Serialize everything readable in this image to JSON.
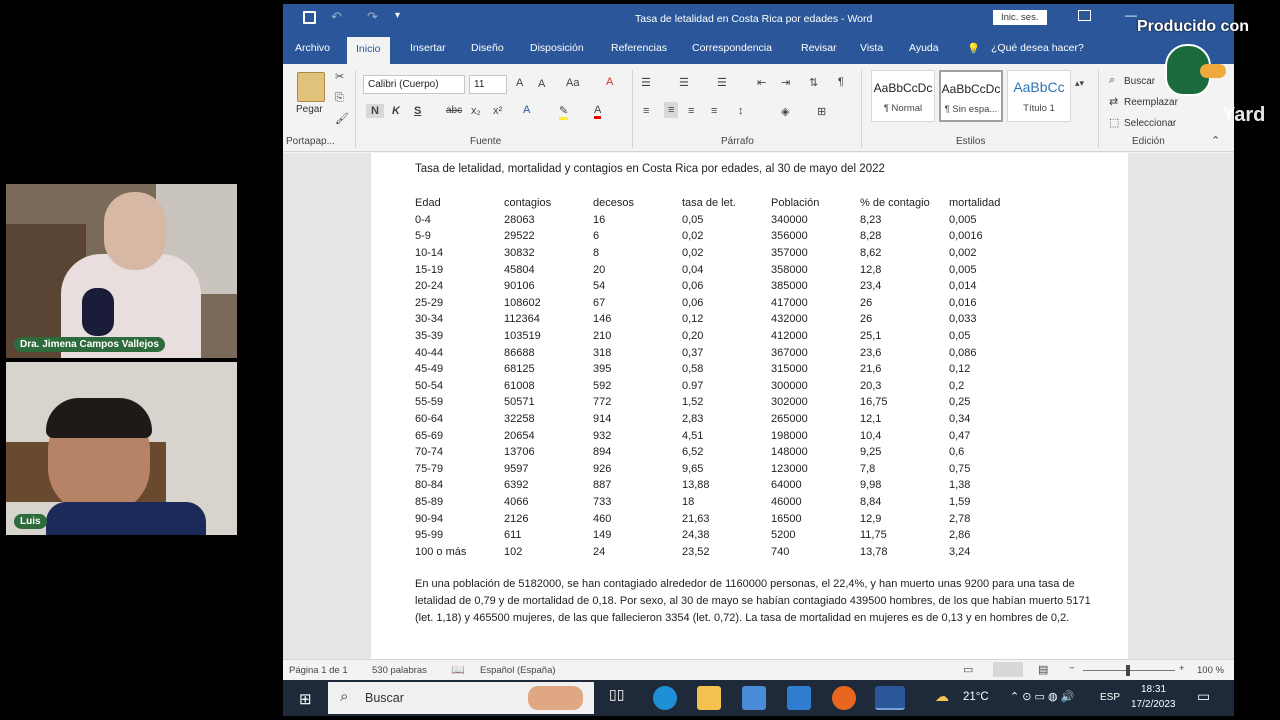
{
  "watermark": "Producido con",
  "watermark_brand": "Yard",
  "cams": [
    {
      "name": "Dra. Jimena Campos Vallejos"
    },
    {
      "name": "Luis"
    }
  ],
  "window": {
    "title": "Tasa de letalidad en Costa Rica por edades  -  Word",
    "signin": "Inic. ses."
  },
  "tabs": [
    "Archivo",
    "Inicio",
    "Insertar",
    "Diseño",
    "Disposición",
    "Referencias",
    "Correspondencia",
    "Revisar",
    "Vista",
    "Ayuda",
    "¿Qué desea hacer?"
  ],
  "ribbon": {
    "paste": "Pegar",
    "font_name": "Calibri (Cuerpo)",
    "font_size": "11",
    "groups": [
      "Portapap...",
      "Fuente",
      "Párrafo",
      "Estilos",
      "Edición"
    ],
    "styles": [
      {
        "preview": "AaBbCcDc",
        "name": "¶ Normal"
      },
      {
        "preview": "AaBbCcDc",
        "name": "¶ Sin espa..."
      },
      {
        "preview": "AaBbCc",
        "name": "Título 1"
      }
    ],
    "search": "Buscar",
    "replace": "Reemplazar",
    "select": "Seleccionar"
  },
  "document": {
    "title": "Tasa de letalidad, mortalidad y contagios en Costa Rica por edades, al 30 de mayo del 2022",
    "columns": [
      "Edad",
      "contagios",
      "decesos",
      "tasa de let.",
      "Población",
      "% de contagio",
      "mortalidad"
    ],
    "rows": [
      [
        "0-4",
        "28063",
        "16",
        "0,05",
        "340000",
        "8,23",
        "0,005"
      ],
      [
        "5-9",
        "29522",
        "6",
        "0,02",
        "356000",
        "8,28",
        "0,0016"
      ],
      [
        "10-14",
        "30832",
        "8",
        "0,02",
        "357000",
        "8,62",
        "0,002"
      ],
      [
        "15-19",
        "45804",
        "20",
        "0,04",
        "358000",
        "12,8",
        "0,005"
      ],
      [
        "20-24",
        "90106",
        "54",
        "0,06",
        "385000",
        "23,4",
        "0,014"
      ],
      [
        "25-29",
        "108602",
        "67",
        "0,06",
        "417000",
        "26",
        "0,016"
      ],
      [
        "30-34",
        "112364",
        "146",
        "0,12",
        "432000",
        "26",
        "0,033"
      ],
      [
        "35-39",
        "103519",
        "210",
        "0,20",
        "412000",
        "25,1",
        "0,05"
      ],
      [
        "40-44",
        "86688",
        "318",
        "0,37",
        "367000",
        "23,6",
        "0,086"
      ],
      [
        "45-49",
        "68125",
        "395",
        "0,58",
        "315000",
        "21,6",
        "0,12"
      ],
      [
        "50-54",
        "61008",
        "592",
        "0.97",
        "300000",
        "20,3",
        "0,2"
      ],
      [
        "55-59",
        "50571",
        "772",
        "1,52",
        "302000",
        "16,75",
        "0,25"
      ],
      [
        "60-64",
        "32258",
        "914",
        "2,83",
        "265000",
        "12,1",
        "0,34"
      ],
      [
        "65-69",
        "20654",
        "932",
        "4,51",
        "198000",
        "10,4",
        "0,47"
      ],
      [
        "70-74",
        "13706",
        "894",
        "6,52",
        "148000",
        "9,25",
        "0,6"
      ],
      [
        "75-79",
        "9597",
        "926",
        "9,65",
        "123000",
        "7,8",
        "0,75"
      ],
      [
        "80-84",
        "6392",
        "887",
        "13,88",
        "64000",
        "9,98",
        "1,38"
      ],
      [
        "85-89",
        "4066",
        "733",
        "18",
        "46000",
        "8,84",
        "1,59"
      ],
      [
        "90-94",
        "2126",
        "460",
        "21,63",
        "16500",
        "12,9",
        "2,78"
      ],
      [
        "95-99",
        "611",
        "149",
        "24,38",
        "5200",
        "11,75",
        "2,86"
      ],
      [
        "100 o más",
        "102",
        "24",
        "23,52",
        "740",
        "13,78",
        "3,24"
      ]
    ],
    "paragraph": "En una población de 5182000, se han contagiado alrededor de 1160000 personas, el 22,4%, y han muerto unas 9200 para una tasa de letalidad de 0,79 y de mortalidad de 0,18. Por sexo, al 30 de mayo se habían contagiado 439500 hombres, de los que habían muerto 5171 (let. 1,18) y 465500 mujeres, de las que fallecieron 3354 (let. 0,72). La tasa de mortalidad en mujeres es de 0,13 y en hombres de 0,2."
  },
  "status": {
    "page": "Página 1 de 1",
    "words": "530 palabras",
    "language": "Español (España)",
    "zoom": "100 %"
  },
  "taskbar": {
    "search": "Buscar",
    "weather": "21°C",
    "lang": "ESP",
    "time": "18:31",
    "date": "17/2/2023"
  },
  "colors": {
    "word_blue": "#2b579a",
    "taskbar": "#1e2a3a",
    "cam_label": "#2d6b3c"
  }
}
